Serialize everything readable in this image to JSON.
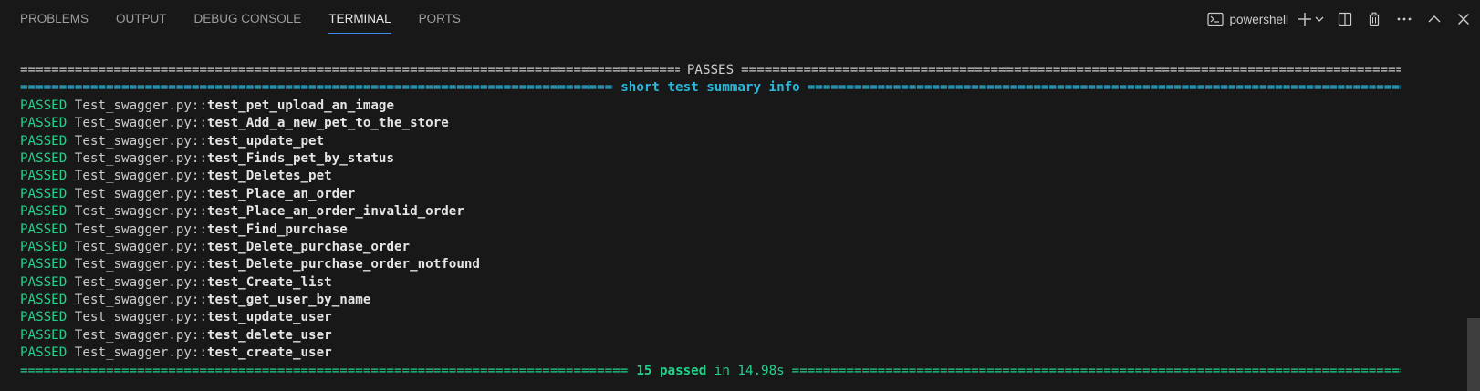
{
  "tabs": [
    {
      "label": "PROBLEMS",
      "active": false
    },
    {
      "label": "OUTPUT",
      "active": false
    },
    {
      "label": "DEBUG CONSOLE",
      "active": false
    },
    {
      "label": "TERMINAL",
      "active": true
    },
    {
      "label": "PORTS",
      "active": false
    }
  ],
  "toolbar": {
    "shell_label": "powershell",
    "icons": [
      "terminal-icon",
      "plus-icon",
      "chevron-down-icon",
      "split-icon",
      "trash-icon",
      "ellipsis-icon",
      "chevron-up-icon",
      "close-icon"
    ]
  },
  "terminal": {
    "passes_header": "PASSES",
    "summary_header": "short test summary info",
    "results": [
      {
        "status": "PASSED",
        "file": "Test_swagger.py",
        "sep": "::",
        "test": "test_pet_upload_an_image"
      },
      {
        "status": "PASSED",
        "file": "Test_swagger.py",
        "sep": "::",
        "test": "test_Add_a_new_pet_to_the_store"
      },
      {
        "status": "PASSED",
        "file": "Test_swagger.py",
        "sep": "::",
        "test": "test_update_pet"
      },
      {
        "status": "PASSED",
        "file": "Test_swagger.py",
        "sep": "::",
        "test": "test_Finds_pet_by_status"
      },
      {
        "status": "PASSED",
        "file": "Test_swagger.py",
        "sep": "::",
        "test": "test_Deletes_pet"
      },
      {
        "status": "PASSED",
        "file": "Test_swagger.py",
        "sep": "::",
        "test": "test_Place_an_order"
      },
      {
        "status": "PASSED",
        "file": "Test_swagger.py",
        "sep": "::",
        "test": "test_Place_an_order_invalid_order"
      },
      {
        "status": "PASSED",
        "file": "Test_swagger.py",
        "sep": "::",
        "test": "test_Find_purchase"
      },
      {
        "status": "PASSED",
        "file": "Test_swagger.py",
        "sep": "::",
        "test": "test_Delete_purchase_order"
      },
      {
        "status": "PASSED",
        "file": "Test_swagger.py",
        "sep": "::",
        "test": "test_Delete_purchase_order_notfound"
      },
      {
        "status": "PASSED",
        "file": "Test_swagger.py",
        "sep": "::",
        "test": "test_Create_list"
      },
      {
        "status": "PASSED",
        "file": "Test_swagger.py",
        "sep": "::",
        "test": "test_get_user_by_name"
      },
      {
        "status": "PASSED",
        "file": "Test_swagger.py",
        "sep": "::",
        "test": "test_update_user"
      },
      {
        "status": "PASSED",
        "file": "Test_swagger.py",
        "sep": "::",
        "test": "test_delete_user"
      },
      {
        "status": "PASSED",
        "file": "Test_swagger.py",
        "sep": "::",
        "test": "test_create_user"
      }
    ],
    "footer_passed": "15 passed",
    "footer_time": "in 14.98s"
  },
  "colors": {
    "background": "#181818",
    "passed_green": "#23d18b",
    "summary_cyan": "#29b8db",
    "active_tab_underline": "#3b8eea"
  }
}
